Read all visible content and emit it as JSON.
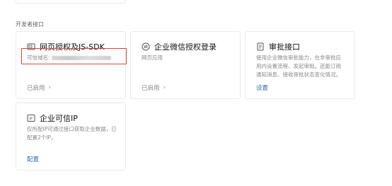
{
  "section_title": "开发者接口",
  "cards": [
    {
      "title": "网页授权及JS-SDK",
      "icon": "web-auth-icon",
      "domain_label": "可信域名:",
      "status": "已启用"
    },
    {
      "title": "企业微信授权登录",
      "icon": "sync-icon",
      "desc": "网页应用",
      "status": "已启用"
    },
    {
      "title": "审批接口",
      "icon": "approval-doc-icon",
      "desc": "使用企业微信审批能力，在非审批应用内设置流程、发起审批。还能订阅通知消息、接收审批状态变化情况。",
      "link": "设置"
    },
    {
      "title": "企业可信IP",
      "icon": "ip-icon",
      "desc": "仅所配IP可通过接口获取企业数据，已配置2个IP。",
      "link": "配置"
    }
  ],
  "colors": {
    "link": "#2f6fb6",
    "highlight": "#e0433a"
  }
}
